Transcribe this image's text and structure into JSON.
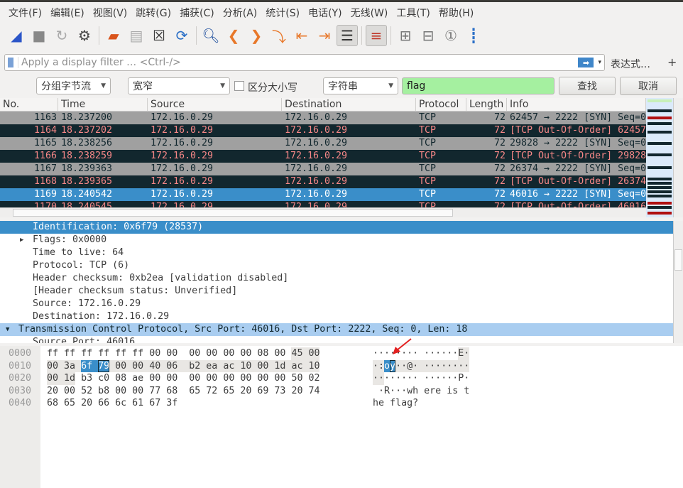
{
  "menu": [
    "文件(F)",
    "编辑(E)",
    "视图(V)",
    "跳转(G)",
    "捕获(C)",
    "分析(A)",
    "统计(S)",
    "电话(Y)",
    "无线(W)",
    "工具(T)",
    "帮助(H)"
  ],
  "toolbar": [
    {
      "icon": "shark-fin-start-icon",
      "glyph": "◢",
      "color": "#2b55c8"
    },
    {
      "icon": "stop-icon",
      "glyph": "■",
      "color": "#888"
    },
    {
      "icon": "restart-icon",
      "glyph": "↻",
      "color": "#aaa"
    },
    {
      "icon": "capture-options-gear-icon",
      "glyph": "⚙",
      "color": "#444"
    },
    {
      "sep": true
    },
    {
      "icon": "open-folder-icon",
      "glyph": "▰",
      "color": "#d9541c"
    },
    {
      "icon": "save-file-icon",
      "glyph": "▤",
      "color": "#aaa"
    },
    {
      "icon": "close-file-icon",
      "glyph": "☒",
      "color": "#333"
    },
    {
      "icon": "reload-file-icon",
      "glyph": "⟳",
      "color": "#2a6fc7"
    },
    {
      "sep": true
    },
    {
      "icon": "find-packet-icon",
      "glyph": "🔍︎",
      "color": "#1f4f9e"
    },
    {
      "icon": "go-back-icon",
      "glyph": "❮",
      "color": "#e8782a"
    },
    {
      "icon": "go-forward-icon",
      "glyph": "❯",
      "color": "#e8782a"
    },
    {
      "icon": "go-to-packet-icon",
      "glyph": "⤵",
      "color": "#e8782a"
    },
    {
      "icon": "first-packet-icon",
      "glyph": "⇤",
      "color": "#e8782a"
    },
    {
      "icon": "last-packet-icon",
      "glyph": "⇥",
      "color": "#e8782a"
    },
    {
      "icon": "autoscroll-icon",
      "glyph": "☰",
      "color": "#333",
      "on": true
    },
    {
      "sep": true
    },
    {
      "icon": "colorize-icon",
      "glyph": "≡",
      "color": "#c0392b",
      "on": true
    },
    {
      "sep": true
    },
    {
      "icon": "zoom-in-icon",
      "glyph": "⊞",
      "color": "#777"
    },
    {
      "icon": "zoom-out-icon",
      "glyph": "⊟",
      "color": "#777"
    },
    {
      "icon": "normal-size-icon",
      "glyph": "①",
      "color": "#777"
    },
    {
      "icon": "resize-columns-icon",
      "glyph": "┋",
      "color": "#2a6fc7"
    }
  ],
  "filter": {
    "placeholder": "Apply a display filter … <Ctrl-/>",
    "expression_label": "表达式…",
    "add_label": "+"
  },
  "find": {
    "search_in": "分组字节流",
    "charset": "宽窄",
    "case_label": "区分大小写",
    "case_checked": false,
    "type": "字符串",
    "value": "flag",
    "find_label": "查找",
    "cancel_label": "取消"
  },
  "packet_list": {
    "columns": [
      "No.",
      "Time",
      "Source",
      "Destination",
      "Protocol",
      "Length",
      "Info"
    ],
    "rows": [
      {
        "no": "1163",
        "time": "18.237200",
        "src": "172.16.0.29",
        "dst": "172.16.0.29",
        "proto": "TCP",
        "len": "72",
        "info": "62457 → 2222 [SYN] Seq=0",
        "style": "gray"
      },
      {
        "no": "1164",
        "time": "18.237202",
        "src": "172.16.0.29",
        "dst": "172.16.0.29",
        "proto": "TCP",
        "len": "72",
        "info": "[TCP Out-Of-Order] 62457",
        "style": "dark"
      },
      {
        "no": "1165",
        "time": "18.238256",
        "src": "172.16.0.29",
        "dst": "172.16.0.29",
        "proto": "TCP",
        "len": "72",
        "info": "29828 → 2222 [SYN] Seq=0",
        "style": "gray"
      },
      {
        "no": "1166",
        "time": "18.238259",
        "src": "172.16.0.29",
        "dst": "172.16.0.29",
        "proto": "TCP",
        "len": "72",
        "info": "[TCP Out-Of-Order] 29828",
        "style": "dark"
      },
      {
        "no": "1167",
        "time": "18.239363",
        "src": "172.16.0.29",
        "dst": "172.16.0.29",
        "proto": "TCP",
        "len": "72",
        "info": "26374 → 2222 [SYN] Seq=0",
        "style": "gray"
      },
      {
        "no": "1168",
        "time": "18.239365",
        "src": "172.16.0.29",
        "dst": "172.16.0.29",
        "proto": "TCP",
        "len": "72",
        "info": "[TCP Out-Of-Order] 26374",
        "style": "dark"
      },
      {
        "no": "1169",
        "time": "18.240542",
        "src": "172.16.0.29",
        "dst": "172.16.0.29",
        "proto": "TCP",
        "len": "72",
        "info": "46016 → 2222 [SYN] Seq=0",
        "style": "sel"
      },
      {
        "no": "1170",
        "time": "18.240545",
        "src": "172.16.0.29",
        "dst": "172.16.0.29",
        "proto": "TCP",
        "len": "72",
        "info": "[TCP Out-Of-Order] 46016",
        "style": "dark"
      }
    ]
  },
  "details": [
    {
      "text": "Identification: 0x6f79 (28537)",
      "indent": 2,
      "selected": true
    },
    {
      "text": "Flags: 0x0000",
      "indent": 2,
      "expander": "▶"
    },
    {
      "text": "Time to live: 64",
      "indent": 2
    },
    {
      "text": "Protocol: TCP (6)",
      "indent": 2
    },
    {
      "text": "Header checksum: 0xb2ea [validation disabled]",
      "indent": 2
    },
    {
      "text": "[Header checksum status: Unverified]",
      "indent": 2
    },
    {
      "text": "Source: 172.16.0.29",
      "indent": 2
    },
    {
      "text": "Destination: 172.16.0.29",
      "indent": 2
    },
    {
      "text": "Transmission Control Protocol, Src Port: 46016, Dst Port: 2222, Seq: 0, Len: 18",
      "indent": 1,
      "expander": "▼",
      "highlight": true
    },
    {
      "text": "Source Port: 46016",
      "indent": 2
    }
  ],
  "bytes": {
    "offsets": [
      "0000",
      "0010",
      "0020",
      "0030",
      "0040"
    ],
    "hex": [
      [
        "ff",
        "ff",
        "ff",
        "ff",
        "ff",
        "ff",
        "00",
        "00",
        "00",
        "00",
        "00",
        "00",
        "08",
        "00",
        "45",
        "00"
      ],
      [
        "00",
        "3a",
        "6f",
        "79",
        "00",
        "00",
        "40",
        "06",
        "b2",
        "ea",
        "ac",
        "10",
        "00",
        "1d",
        "ac",
        "10"
      ],
      [
        "00",
        "1d",
        "b3",
        "c0",
        "08",
        "ae",
        "00",
        "00",
        "00",
        "00",
        "00",
        "00",
        "00",
        "00",
        "50",
        "02"
      ],
      [
        "20",
        "00",
        "52",
        "b8",
        "00",
        "00",
        "77",
        "68",
        "65",
        "72",
        "65",
        "20",
        "69",
        "73",
        "20",
        "74"
      ],
      [
        "68",
        "65",
        "20",
        "66",
        "6c",
        "61",
        "67",
        "3f"
      ]
    ],
    "ascii": [
      [
        "·",
        "·",
        "·",
        "·",
        "·",
        "·",
        "·",
        "·",
        "·",
        "·",
        "·",
        "·",
        "·",
        "·",
        "E",
        "·"
      ],
      [
        "·",
        ":",
        "o",
        "y",
        "·",
        "·",
        "@",
        "·",
        "·",
        "·",
        "·",
        "·",
        "·",
        "·",
        "·",
        "·"
      ],
      [
        "·",
        "·",
        "·",
        "·",
        "·",
        "·",
        "·",
        "·",
        "·",
        "·",
        "·",
        "·",
        "·",
        "·",
        "P",
        "·"
      ],
      [
        " ",
        "·",
        "R",
        "·",
        "·",
        "·",
        "w",
        "h",
        "e",
        "r",
        "e",
        " ",
        "i",
        "s",
        " ",
        "t"
      ],
      [
        "h",
        "e",
        " ",
        "f",
        "l",
        "a",
        "g",
        "?"
      ]
    ],
    "field_range": [
      14,
      33
    ],
    "selected_range": [
      18,
      19
    ]
  },
  "colors": {
    "selected": "#3a8ec9",
    "gray_row": "#a0a0a0",
    "dark_row": "#12272e",
    "dark_row_text": "#f78787",
    "find_match": "#a5f0a0",
    "annotation_arrow": "#e32020"
  }
}
